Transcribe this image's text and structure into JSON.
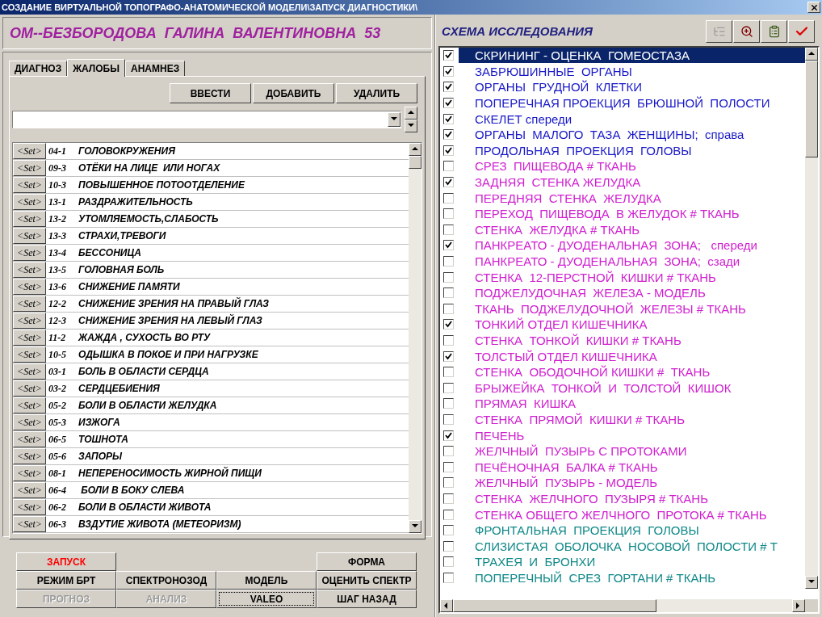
{
  "window": {
    "title": "СОЗДАНИЕ ВИРТУАЛЬНОЙ ТОПОГРАФО-АНАТОМИЧЕСКОЙ МОДЕЛИ\\ЗАПУСК ДИАГНОСТИКИ\\"
  },
  "patient": "ОМ--БЕЗБОРОДОВА  ГАЛИНА  ВАЛЕНТИНОВНА  53",
  "tabs": [
    {
      "label": "ДИАГНОЗ",
      "selected": false
    },
    {
      "label": "ЖАЛОБЫ",
      "selected": true
    },
    {
      "label": "АНАМНЕЗ",
      "selected": false
    }
  ],
  "actions": [
    "ВВЕСТИ",
    "ДОБАВИТЬ",
    "УДАЛИТЬ"
  ],
  "complaints": [
    {
      "button": "<Set>",
      "code": "04-1",
      "text": "ГОЛОВОКРУЖЕНИЯ"
    },
    {
      "button": "<Set>",
      "code": "09-3",
      "text": "ОТЁКИ НА ЛИЦЕ  ИЛИ НОГАХ"
    },
    {
      "button": "<Set>",
      "code": "10-3",
      "text": "ПОВЫШЕННОЕ ПОТООТДЕЛЕНИЕ"
    },
    {
      "button": "<Set>",
      "code": "13-1",
      "text": "РАЗДРАЖИТЕЛЬНОСТЬ"
    },
    {
      "button": "<Set>",
      "code": "13-2",
      "text": "УТОМЛЯЕМОСТЬ,СЛАБОСТЬ"
    },
    {
      "button": "<Set>",
      "code": "13-3",
      "text": "СТРАХИ,ТРЕВОГИ"
    },
    {
      "button": "<Set>",
      "code": "13-4",
      "text": "БЕССОНИЦА"
    },
    {
      "button": "<Set>",
      "code": "13-5",
      "text": "ГОЛОВНАЯ БОЛЬ"
    },
    {
      "button": "<Set>",
      "code": "13-6",
      "text": "СНИЖЕНИЕ ПАМЯТИ"
    },
    {
      "button": "<Set>",
      "code": "12-2",
      "text": "СНИЖЕНИЕ ЗРЕНИЯ НА ПРАВЫЙ ГЛАЗ"
    },
    {
      "button": "<Set>",
      "code": "12-3",
      "text": "СНИЖЕНИЕ ЗРЕНИЯ НА ЛЕВЫЙ ГЛАЗ"
    },
    {
      "button": "<Set>",
      "code": "11-2",
      "text": "ЖАЖДА , СУХОСТЬ ВО РТУ"
    },
    {
      "button": "<Set>",
      "code": "10-5",
      "text": "ОДЫШКА В ПОКОЕ И ПРИ НАГРУЗКЕ"
    },
    {
      "button": "<Set>",
      "code": "03-1",
      "text": "БОЛЬ В ОБЛАСТИ СЕРДЦА"
    },
    {
      "button": "<Set>",
      "code": "03-2",
      "text": "СЕРДЦЕБИЕНИЯ"
    },
    {
      "button": "<Set>",
      "code": "05-2",
      "text": "БОЛИ В ОБЛАСТИ ЖЕЛУДКА"
    },
    {
      "button": "<Set>",
      "code": "05-3",
      "text": "ИЗЖОГА"
    },
    {
      "button": "<Set>",
      "code": "06-5",
      "text": "ТОШНОТА"
    },
    {
      "button": "<Set>",
      "code": "05-6",
      "text": "ЗАПОРЫ"
    },
    {
      "button": "<Set>",
      "code": "08-1",
      "text": "НЕПЕРЕНОСИМОСТЬ ЖИРНОЙ ПИЩИ"
    },
    {
      "button": "<Set>",
      "code": "06-4",
      "text": " БОЛИ В БОКУ СЛЕВА"
    },
    {
      "button": "<Set>",
      "code": "06-2",
      "text": "БОЛИ В ОБЛАСТИ ЖИВОТА"
    },
    {
      "button": "<Set>",
      "code": "06-3",
      "text": "ВЗДУТИЕ ЖИВОТА (МЕТЕОРИЗМ)"
    }
  ],
  "buttons": [
    [
      {
        "kind": "button",
        "label": "ЗАПУСК",
        "color": "#ff0000",
        "disabled": false,
        "focused": false
      },
      {
        "kind": "gap"
      },
      {
        "kind": "gap"
      },
      {
        "kind": "button",
        "label": "ФОРМА",
        "color": "#000000",
        "disabled": false,
        "focused": false
      }
    ],
    [
      {
        "kind": "button",
        "label": "РЕЖИМ БРТ",
        "color": "#000000",
        "disabled": false,
        "focused": false
      },
      {
        "kind": "button",
        "label": "СПЕКТРОНОЗОД",
        "color": "#000000",
        "disabled": false,
        "focused": false
      },
      {
        "kind": "button",
        "label": "МОДЕЛЬ",
        "color": "#000000",
        "disabled": false,
        "focused": false
      },
      {
        "kind": "button",
        "label": "ОЦЕНИТЬ СПЕКТР",
        "color": "#000000",
        "disabled": false,
        "focused": false
      }
    ],
    [
      {
        "kind": "button",
        "label": "ПРОГНОЗ",
        "disabled": true,
        "focused": false
      },
      {
        "kind": "button",
        "label": "АНАЛИЗ",
        "disabled": true,
        "focused": false
      },
      {
        "kind": "button",
        "label": "VALEO",
        "color": "#000000",
        "disabled": false,
        "focused": true
      },
      {
        "kind": "button",
        "label": "ШАГ НАЗАД",
        "color": "#000000",
        "disabled": false,
        "focused": false
      }
    ]
  ],
  "scheme": {
    "title": "СХЕМА ИССЛЕДОВАНИЯ",
    "toolbar": [
      {
        "kind": "tree",
        "disabled": true
      },
      {
        "kind": "zoom",
        "disabled": false
      },
      {
        "kind": "document",
        "disabled": false
      },
      {
        "kind": "check",
        "disabled": false
      }
    ],
    "items": [
      {
        "label": "СКРИНИНГ - ОЦЕНКА  ГОМЕОСТАЗА",
        "checked": true,
        "selected": true
      },
      {
        "label": "ЗАБРЮШИННЫЕ  ОРГАНЫ",
        "checked": true,
        "selected": false,
        "color": "#1818c8"
      },
      {
        "label": "ОРГАНЫ  ГРУДНОЙ  КЛЕТКИ",
        "checked": true,
        "selected": false,
        "color": "#1818c8"
      },
      {
        "label": "ПОПЕРЕЧНАЯ ПРОЕКЦИЯ  БРЮШНОЙ  ПОЛОСТИ",
        "checked": true,
        "selected": false,
        "color": "#1818c8"
      },
      {
        "label": "СКЕЛЕТ спереди",
        "checked": true,
        "selected": false,
        "color": "#1818c8"
      },
      {
        "label": "ОРГАНЫ  МАЛОГО  ТАЗА  ЖЕНЩИНЫ;  справа",
        "checked": true,
        "selected": false,
        "color": "#1818c8"
      },
      {
        "label": "ПРОДОЛЬНАЯ  ПРОЕКЦИЯ  ГОЛОВЫ",
        "checked": true,
        "selected": false,
        "color": "#1818c8"
      },
      {
        "label": "СРЕЗ  ПИЩЕВОДА # ТКАНЬ",
        "checked": false,
        "selected": false,
        "color": "#d020d0"
      },
      {
        "label": "ЗАДНЯЯ  СТЕНКА ЖЕЛУДКА",
        "checked": true,
        "selected": false,
        "color": "#d020d0"
      },
      {
        "label": "ПЕРЕДНЯЯ  СТЕНКА  ЖЕЛУДКА",
        "checked": false,
        "selected": false,
        "color": "#d020d0"
      },
      {
        "label": "ПЕРЕХОД  ПИЩЕВОДА  В ЖЕЛУДОК # ТКАНЬ",
        "checked": false,
        "selected": false,
        "color": "#d020d0"
      },
      {
        "label": "СТЕНКА  ЖЕЛУДКА # ТКАНЬ",
        "checked": false,
        "selected": false,
        "color": "#d020d0"
      },
      {
        "label": "ПАНКРЕАТО - ДУОДЕНАЛЬНАЯ  ЗОНА;   спереди",
        "checked": true,
        "selected": false,
        "color": "#d020d0"
      },
      {
        "label": "ПАНКРЕАТО - ДУОДЕНАЛЬНАЯ  ЗОНА;  сзади",
        "checked": false,
        "selected": false,
        "color": "#d020d0"
      },
      {
        "label": "СТЕНКА  12-ПЕРСТНОЙ  КИШКИ # ТКАНЬ",
        "checked": false,
        "selected": false,
        "color": "#d020d0"
      },
      {
        "label": "ПОДЖЕЛУДОЧНАЯ  ЖЕЛЕЗА - МОДЕЛЬ",
        "checked": false,
        "selected": false,
        "color": "#d020d0"
      },
      {
        "label": "ТКАНЬ  ПОДЖЕЛУДОЧНОЙ  ЖЕЛЕЗЫ # ТКАНЬ",
        "checked": false,
        "selected": false,
        "color": "#d020d0"
      },
      {
        "label": "ТОНКИЙ ОТДЕЛ КИШЕЧНИКА",
        "checked": true,
        "selected": false,
        "color": "#d020d0"
      },
      {
        "label": "СТЕНКА  ТОНКОЙ  КИШКИ # ТКАНЬ",
        "checked": false,
        "selected": false,
        "color": "#d020d0"
      },
      {
        "label": "ТОЛСТЫЙ ОТДЕЛ КИШЕЧНИКА",
        "checked": true,
        "selected": false,
        "color": "#d020d0"
      },
      {
        "label": "СТЕНКА  ОБОДОЧНОЙ КИШКИ #  ТКАНЬ",
        "checked": false,
        "selected": false,
        "color": "#d020d0"
      },
      {
        "label": "БРЫЖЕЙКА  ТОНКОЙ  И  ТОЛСТОЙ  КИШОК",
        "checked": false,
        "selected": false,
        "color": "#d020d0"
      },
      {
        "label": "ПРЯМАЯ  КИШКА",
        "checked": false,
        "selected": false,
        "color": "#d020d0"
      },
      {
        "label": "СТЕНКА  ПРЯМОЙ  КИШКИ # ТКАНЬ",
        "checked": false,
        "selected": false,
        "color": "#d020d0"
      },
      {
        "label": "ПЕЧЕНЬ",
        "checked": true,
        "selected": false,
        "color": "#d020d0"
      },
      {
        "label": "ЖЕЛЧНЫЙ  ПУЗЫРЬ С ПРОТОКАМИ",
        "checked": false,
        "selected": false,
        "color": "#d020d0"
      },
      {
        "label": "ПЕЧЁНОЧНАЯ  БАЛКА # ТКАНЬ",
        "checked": false,
        "selected": false,
        "color": "#d020d0"
      },
      {
        "label": "ЖЕЛЧНЫЙ  ПУЗЫРЬ - МОДЕЛЬ",
        "checked": false,
        "selected": false,
        "color": "#d020d0"
      },
      {
        "label": "СТЕНКА  ЖЕЛЧНОГО  ПУЗЫРЯ # ТКАНЬ",
        "checked": false,
        "selected": false,
        "color": "#d020d0"
      },
      {
        "label": "СТЕНКА ОБЩЕГО ЖЕЛЧНОГО  ПРОТОКА # ТКАНЬ",
        "checked": false,
        "selected": false,
        "color": "#d020d0"
      },
      {
        "label": "ФРОНТАЛЬНАЯ  ПРОЕКЦИЯ  ГОЛОВЫ",
        "checked": false,
        "selected": false,
        "color": "#108888"
      },
      {
        "label": "СЛИЗИСТАЯ  ОБОЛОЧКА  НОСОВОЙ  ПОЛОСТИ # Т",
        "checked": false,
        "selected": false,
        "color": "#108888"
      },
      {
        "label": "ТРАХЕЯ  И  БРОНХИ",
        "checked": false,
        "selected": false,
        "color": "#108888"
      },
      {
        "label": "ПОПЕРЕЧНЫЙ  СРЕЗ  ГОРТАНИ # ТКАНЬ",
        "checked": false,
        "selected": false,
        "color": "#108888"
      }
    ]
  }
}
